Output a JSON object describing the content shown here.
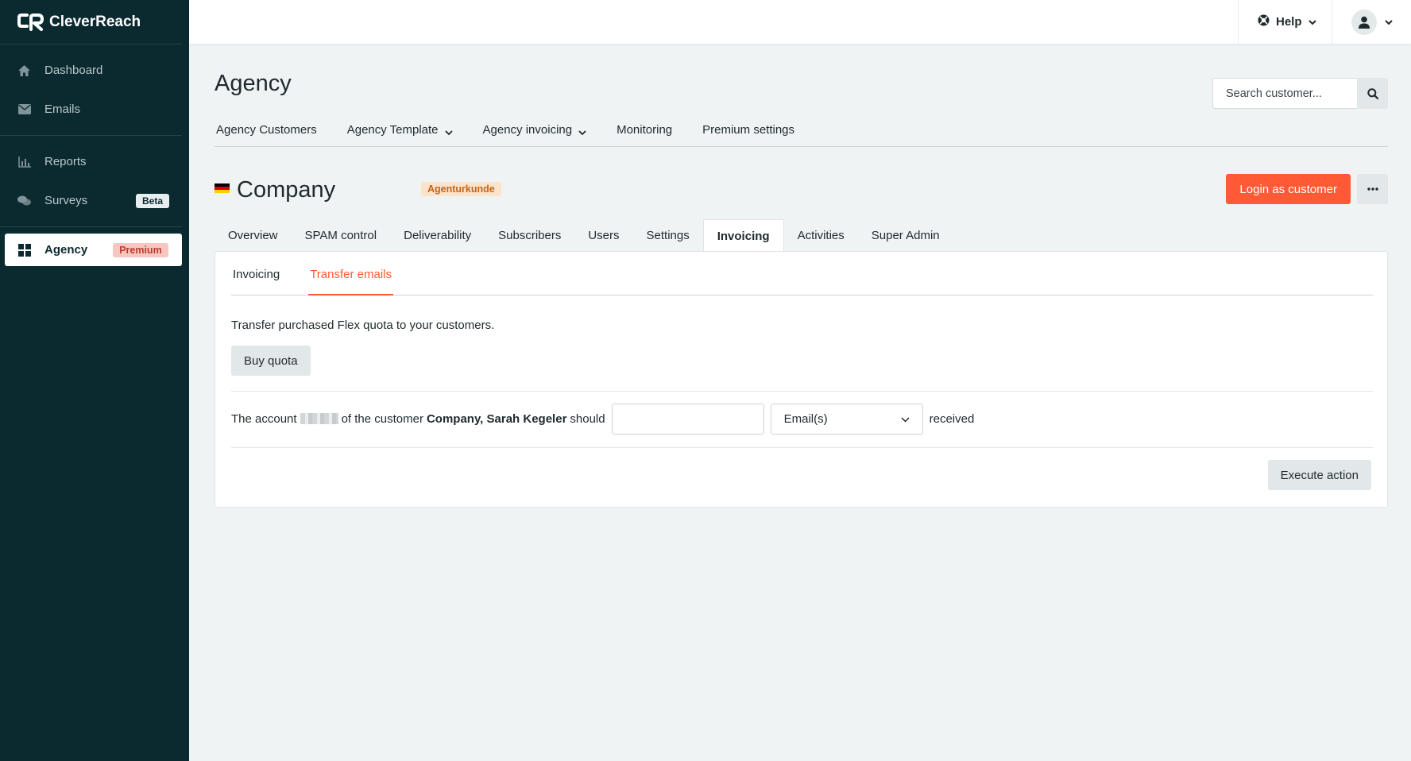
{
  "brand": {
    "name": "CleverReach",
    "accent": "#ff5a36",
    "sidebar_bg": "#0b2a30"
  },
  "sidebar": {
    "items": [
      {
        "label": "Dashboard",
        "icon": "home-icon"
      },
      {
        "label": "Emails",
        "icon": "envelope-icon"
      },
      {
        "label": "Reports",
        "icon": "bar-chart-icon"
      },
      {
        "label": "Surveys",
        "icon": "chat-bubbles-icon",
        "badge": "Beta"
      },
      {
        "label": "Agency",
        "icon": "grid-icon",
        "badge": "Premium",
        "active": true
      }
    ]
  },
  "topbar": {
    "help_label": "Help",
    "help_icon": "lifebuoy-icon",
    "user_icon": "user-icon"
  },
  "page": {
    "title": "Agency",
    "search_placeholder": "Search customer...",
    "tabs": [
      {
        "label": "Agency Customers"
      },
      {
        "label": "Agency Template",
        "dropdown": true
      },
      {
        "label": "Agency invoicing",
        "dropdown": true
      },
      {
        "label": "Monitoring"
      },
      {
        "label": "Premium settings"
      }
    ]
  },
  "customer": {
    "name": "Company",
    "badge": "Agenturkunde",
    "login_button": "Login as customer",
    "more_icon": "ellipsis-icon",
    "tabs": [
      "Overview",
      "SPAM control",
      "Deliverability",
      "Subscribers",
      "Users",
      "Settings",
      "Invoicing",
      "Activities",
      "Super Admin"
    ],
    "active_tab": "Invoicing"
  },
  "invoicing": {
    "sub_tabs": [
      "Invoicing",
      "Transfer emails"
    ],
    "active_sub_tab": "Transfer emails",
    "description": "Transfer purchased Flex quota to your customers.",
    "buy_button": "Buy quota",
    "sentence": {
      "part1": "The account",
      "part2": "of the customer",
      "customer": "Company, Sarah Kegeler",
      "part3": "should",
      "part4": "received"
    },
    "amount_value": "",
    "unit_selected": "Email(s)",
    "execute_button": "Execute action"
  }
}
